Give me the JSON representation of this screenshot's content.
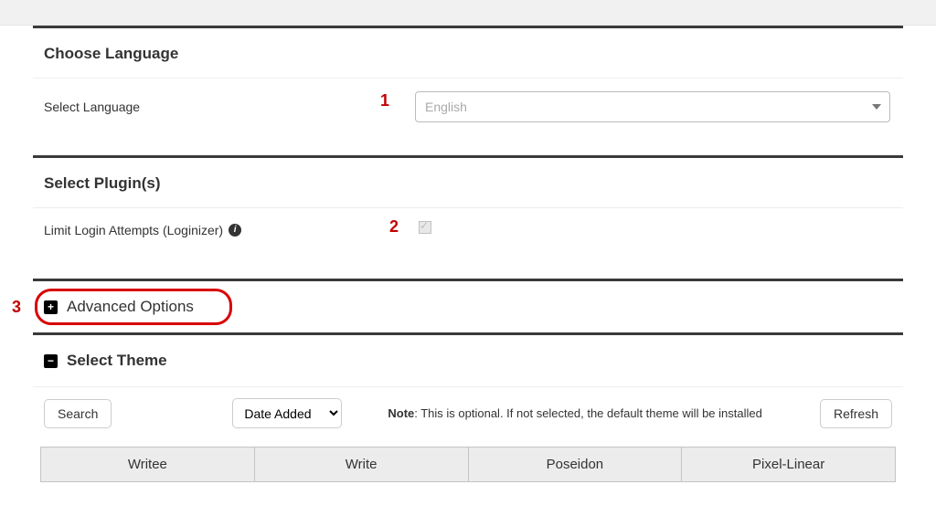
{
  "annotations": {
    "a1": "1",
    "a2": "2",
    "a3": "3"
  },
  "language": {
    "heading": "Choose Language",
    "label": "Select Language",
    "selected": "English"
  },
  "plugins": {
    "heading": "Select Plugin(s)",
    "loginizer_label": "Limit Login Attempts (Loginizer)"
  },
  "advanced": {
    "heading": "Advanced Options"
  },
  "theme": {
    "heading": "Select Theme",
    "search_btn": "Search",
    "sort_selected": "Date Added",
    "note_bold": "Note",
    "note_text": ": This is optional. If not selected, the default theme will be installed",
    "refresh_btn": "Refresh",
    "items": [
      "Writee",
      "Write",
      "Poseidon",
      "Pixel-Linear"
    ]
  }
}
